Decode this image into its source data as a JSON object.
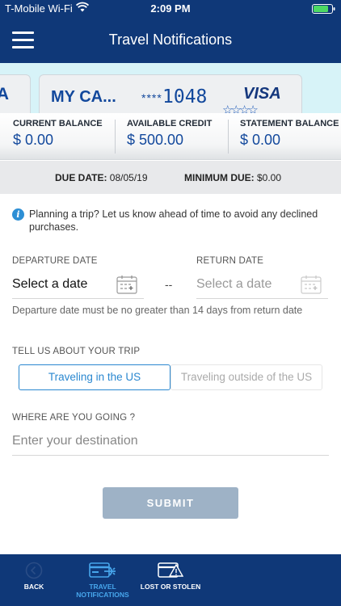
{
  "status_bar": {
    "carrier": "T-Mobile Wi-Fi",
    "time": "2:09 PM"
  },
  "header": {
    "title": "Travel Notifications",
    "menu_icon": "hamburger-menu-icon"
  },
  "cards": {
    "prev_card_text": "A",
    "name": "MY CA...",
    "mask": "****",
    "last4": "1048",
    "brand": "VISA"
  },
  "balances": {
    "current": {
      "label": "CURRENT BALANCE",
      "value": "$ 0.00"
    },
    "available": {
      "label": "AVAILABLE CREDIT",
      "value": "$ 500.00"
    },
    "statement": {
      "label": "STATEMENT BALANCE",
      "value": "$ 0.00"
    }
  },
  "due": {
    "due_label": "DUE DATE:",
    "due_value": "08/05/19",
    "min_label": "MINIMUM DUE:",
    "min_value": "$0.00"
  },
  "info": {
    "text": "Planning a trip? Let us know ahead of time to avoid any declined purchases."
  },
  "dates": {
    "departure_label": "DEPARTURE DATE",
    "departure_value": "Select a date",
    "separator": "--",
    "return_label": "RETURN DATE",
    "return_value": "Select a date",
    "hint": "Departure date must be no greater than 14 days from return date"
  },
  "trip": {
    "label": "TELL US ABOUT YOUR TRIP",
    "option_us": "Traveling in the US",
    "option_outside": "Traveling outside of the US",
    "selected": "Traveling in the US"
  },
  "destination": {
    "label": "WHERE ARE YOU GOING ?",
    "placeholder": "Enter your destination",
    "value": ""
  },
  "submit_label": "SUBMIT",
  "colors": {
    "header": "#0f3878",
    "accent": "#2b88d0",
    "submit_disabled": "#9eb2c6",
    "tab_active": "#47a6ec"
  },
  "tabbar": {
    "back": "BACK",
    "travel_line1": "TRAVEL",
    "travel_line2": "NOTIFICATIONS",
    "lost": "LOST OR STOLEN",
    "active": "TRAVEL NOTIFICATIONS"
  }
}
